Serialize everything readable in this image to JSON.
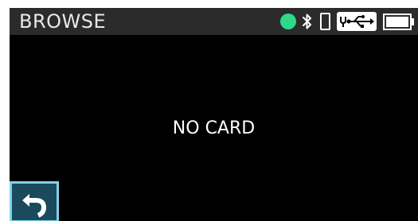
{
  "header": {
    "title": "BROWSE"
  },
  "status_bar": {
    "connection_indicator": "green-dot",
    "connection_color": "#2ed98a",
    "icons": [
      "bluetooth-icon",
      "phone-icon",
      "usb-power-icon",
      "battery-icon"
    ]
  },
  "main": {
    "message": "NO CARD"
  },
  "footer": {
    "back_button_icon": "back-arrow-icon",
    "back_button_color": "#1a4a5c",
    "back_button_border": "#7fd3e8"
  }
}
